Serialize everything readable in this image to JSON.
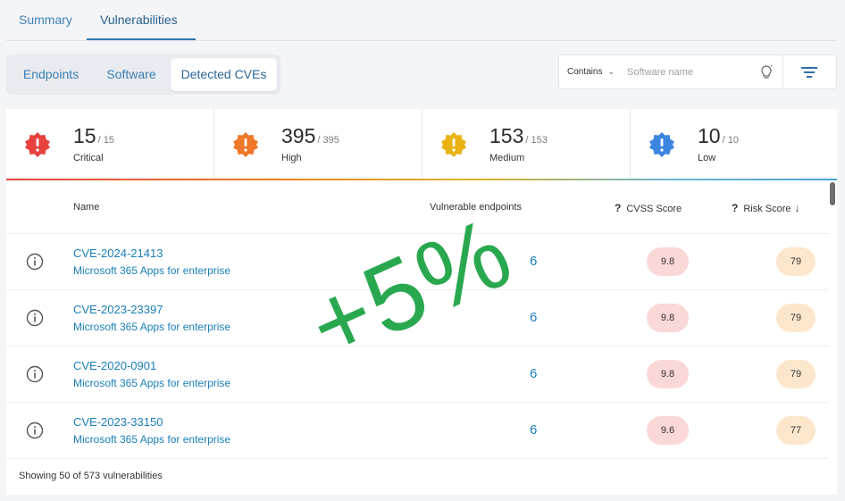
{
  "top_tabs": [
    {
      "label": "Summary"
    },
    {
      "label": "Vulnerabilities"
    }
  ],
  "segment_tabs": [
    {
      "label": "Endpoints"
    },
    {
      "label": "Software"
    },
    {
      "label": "Detected CVEs"
    }
  ],
  "search": {
    "mode_label": "Contains",
    "placeholder": "Software name"
  },
  "severity": [
    {
      "count": "15",
      "total": "/ 15",
      "label": "Critical",
      "color": "#e8423f"
    },
    {
      "count": "395",
      "total": "/ 395",
      "label": "High",
      "color": "#f0782a"
    },
    {
      "count": "153",
      "total": "/ 153",
      "label": "Medium",
      "color": "#e9b313"
    },
    {
      "count": "10",
      "total": "/ 10",
      "label": "Low",
      "color": "#3b86e0"
    }
  ],
  "table": {
    "headers": {
      "name": "Name",
      "endpoints": "Vulnerable endpoints",
      "cvss": "CVSS Score",
      "risk": "Risk Score",
      "help_mark": "?",
      "sort_arrow": "↓"
    },
    "rows": [
      {
        "cve": "CVE-2024-21413",
        "software": "Microsoft 365 Apps for enterprise",
        "endpoints": "6",
        "cvss": "9.8",
        "risk": "79"
      },
      {
        "cve": "CVE-2023-23397",
        "software": "Microsoft 365 Apps for enterprise",
        "endpoints": "6",
        "cvss": "9.8",
        "risk": "79"
      },
      {
        "cve": "CVE-2020-0901",
        "software": "Microsoft 365 Apps for enterprise",
        "endpoints": "6",
        "cvss": "9.8",
        "risk": "79"
      },
      {
        "cve": "CVE-2023-33150",
        "software": "Microsoft 365 Apps for enterprise",
        "endpoints": "6",
        "cvss": "9.6",
        "risk": "77"
      }
    ]
  },
  "footer": {
    "text": "Showing 50 of 573 vulnerabilities"
  },
  "watermark": {
    "text": "+5%"
  }
}
